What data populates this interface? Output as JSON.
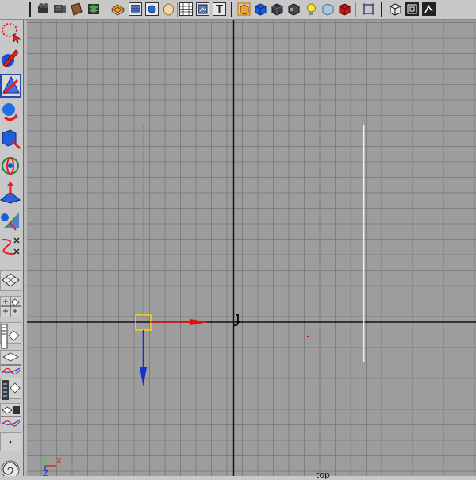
{
  "top_toolbar": {
    "icons": [
      "toolbar-grip-icon",
      "hypershade-icon",
      "render-view-icon",
      "render-icon",
      "ipr-render-icon",
      "render-globals-icon",
      "show-grid-icon",
      "wireframe-icon",
      "shaded-icon",
      "lights-icon",
      "textured-icon",
      "camera-attributes-icon",
      "image-plane-icon",
      "shelf-icon",
      "cube-icon",
      "blue-cube-icon",
      "dark-cube-icon",
      "light-icon",
      "cube-light-icon",
      "red-cube-icon",
      "isolate-select-icon",
      "xray-icon",
      "frame-all-icon",
      "snap-icon"
    ]
  },
  "toolbox": {
    "tools": [
      "select-tool-icon",
      "lasso-tool-icon",
      "paint-select-tool-icon",
      "move-tool-icon",
      "rotate-tool-icon",
      "scale-tool-icon",
      "universal-manipulator-icon",
      "soft-mod-tool-icon",
      "show-manipulator-icon",
      "last-tool-icon"
    ],
    "active_tool": "move-tool-icon",
    "layouts": [
      "single-perspective-layout-icon",
      "four-view-layout-icon",
      "perspective-outliner-layout-icon",
      "graph-editor-layout-icon",
      "hypershade-layout-icon",
      "dope-sheet-layout-icon"
    ]
  },
  "viewport": {
    "camera_label": "top",
    "axis_labels": {
      "x": "X",
      "z": "Z"
    }
  },
  "colors": {
    "viewport_background": "#9d9d9d",
    "grid_line": "#7e7e7e",
    "axis_line": "#111111",
    "x_axis": "#e01010",
    "y_axis": "#28d040",
    "z_axis": "#1030d0",
    "selection_highlight": "#ffd000"
  }
}
